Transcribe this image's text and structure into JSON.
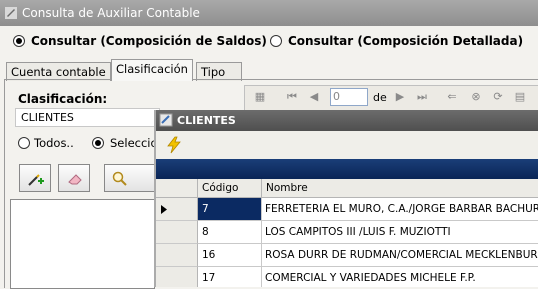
{
  "window": {
    "title": "Consulta de Auxiliar Contable"
  },
  "query_mode": {
    "options": [
      {
        "label": "Consultar (Composición de Saldos)",
        "selected": true
      },
      {
        "label": "Consultar (Composición Detallada)",
        "selected": false
      }
    ]
  },
  "tabs": [
    {
      "label": "Cuenta contable",
      "active": false
    },
    {
      "label": "Clasificación",
      "active": true
    },
    {
      "label": "Tipo",
      "active": false
    }
  ],
  "clasificacion": {
    "label": "Clasificación:",
    "value": "CLIENTES",
    "scope_todos": "Todos..",
    "scope_seleccion": "Seleccio"
  },
  "navigator": {
    "page_value": "0",
    "of_label": "de"
  },
  "dialog": {
    "title": "CLIENTES",
    "columns": [
      "Código",
      "Nombre"
    ],
    "rows": [
      {
        "code": "7",
        "name": "FERRETERIA EL MURO, C.A./JORGE BARBAR BACHUR",
        "selected": true
      },
      {
        "code": "8",
        "name": "LOS CAMPITOS III /LUIS F. MUZIOTTI",
        "selected": false
      },
      {
        "code": "16",
        "name": "ROSA DURR DE RUDMAN/COMERCIAL MECKLENBURG",
        "selected": false
      },
      {
        "code": "17",
        "name": "COMERCIAL Y VARIEDADES MICHELE F.P.",
        "selected": false
      }
    ]
  },
  "colors": {
    "selection": "#0b2a62",
    "dialog_band": "#0a2556",
    "title_gray": "#8e8e8e"
  }
}
